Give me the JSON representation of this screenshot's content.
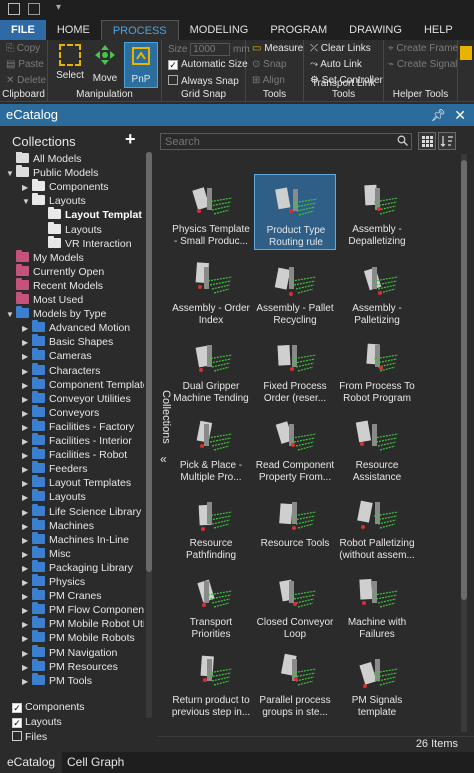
{
  "ribbon_tabs": [
    "FILE",
    "HOME",
    "PROCESS",
    "MODELING",
    "PROGRAM",
    "DRAWING",
    "HELP"
  ],
  "active_tab": "PROCESS",
  "clipboard": {
    "copy": "Copy",
    "paste": "Paste",
    "delete": "Delete",
    "label": "Clipboard"
  },
  "manipulation": {
    "select": "Select",
    "move": "Move",
    "pnp": "PnP",
    "label": "Manipulation"
  },
  "grid_snap": {
    "size_label": "Size",
    "size_value": "1000",
    "size_unit": "mm",
    "automatic_size": "Automatic Size",
    "always_snap": "Always Snap",
    "label": "Grid Snap"
  },
  "tools": {
    "measure": "Measure",
    "snap": "Snap",
    "align": "Align",
    "label": "Tools"
  },
  "transport": {
    "clear_links": "Clear Links",
    "auto_link": "Auto Link",
    "set_controller": "Set Controller",
    "label": "Transport Link Tools"
  },
  "helper": {
    "create_frame": "Create Frame",
    "create_signal": "Create Signal",
    "label": "Helper Tools"
  },
  "panel_title": "eCatalog",
  "collections_title": "Collections",
  "collections_tab_label": "Collections",
  "search_placeholder": "Search",
  "tree": [
    {
      "label": "All Models",
      "indent": 0,
      "arrow": "",
      "color": "#dcdcdc"
    },
    {
      "label": "Public Models",
      "indent": 0,
      "arrow": "▼",
      "color": "#dcdcdc"
    },
    {
      "label": "Components",
      "indent": 1,
      "arrow": "▶",
      "color": "#e8e8e8"
    },
    {
      "label": "Layouts",
      "indent": 1,
      "arrow": "▼",
      "color": "#e8e8e8"
    },
    {
      "label": "Layout Templat",
      "indent": 2,
      "arrow": "",
      "color": "#e8e8e8",
      "bold": true
    },
    {
      "label": "Layouts",
      "indent": 2,
      "arrow": "",
      "color": "#e8e8e8"
    },
    {
      "label": "VR Interaction",
      "indent": 2,
      "arrow": "",
      "color": "#e8e8e8"
    },
    {
      "label": "My Models",
      "indent": 0,
      "arrow": "",
      "color": "#c4527d"
    },
    {
      "label": "Currently Open",
      "indent": 0,
      "arrow": "",
      "color": "#c4527d"
    },
    {
      "label": "Recent Models",
      "indent": 0,
      "arrow": "",
      "color": "#c4527d"
    },
    {
      "label": "Most Used",
      "indent": 0,
      "arrow": "",
      "color": "#c4527d"
    },
    {
      "label": "Models by Type",
      "indent": 0,
      "arrow": "▼",
      "color": "#3a7fd0"
    },
    {
      "label": "Advanced Motion",
      "indent": 1,
      "arrow": "▶",
      "color": "#3a7fd0"
    },
    {
      "label": "Basic Shapes",
      "indent": 1,
      "arrow": "▶",
      "color": "#3a7fd0"
    },
    {
      "label": "Cameras",
      "indent": 1,
      "arrow": "▶",
      "color": "#3a7fd0"
    },
    {
      "label": "Characters",
      "indent": 1,
      "arrow": "▶",
      "color": "#3a7fd0"
    },
    {
      "label": "Component Template",
      "indent": 1,
      "arrow": "▶",
      "color": "#3a7fd0"
    },
    {
      "label": "Conveyor Utilities",
      "indent": 1,
      "arrow": "▶",
      "color": "#3a7fd0"
    },
    {
      "label": "Conveyors",
      "indent": 1,
      "arrow": "▶",
      "color": "#3a7fd0"
    },
    {
      "label": "Facilities - Factory",
      "indent": 1,
      "arrow": "▶",
      "color": "#3a7fd0"
    },
    {
      "label": "Facilities - Interior",
      "indent": 1,
      "arrow": "▶",
      "color": "#3a7fd0"
    },
    {
      "label": "Facilities - Robot",
      "indent": 1,
      "arrow": "▶",
      "color": "#3a7fd0"
    },
    {
      "label": "Feeders",
      "indent": 1,
      "arrow": "▶",
      "color": "#3a7fd0"
    },
    {
      "label": "Layout Templates",
      "indent": 1,
      "arrow": "▶",
      "color": "#3a7fd0"
    },
    {
      "label": "Layouts",
      "indent": 1,
      "arrow": "▶",
      "color": "#3a7fd0"
    },
    {
      "label": "Life Science Library",
      "indent": 1,
      "arrow": "▶",
      "color": "#3a7fd0"
    },
    {
      "label": "Machines",
      "indent": 1,
      "arrow": "▶",
      "color": "#3a7fd0"
    },
    {
      "label": "Machines In-Line",
      "indent": 1,
      "arrow": "▶",
      "color": "#3a7fd0"
    },
    {
      "label": "Misc",
      "indent": 1,
      "arrow": "▶",
      "color": "#3a7fd0"
    },
    {
      "label": "Packaging Library",
      "indent": 1,
      "arrow": "▶",
      "color": "#3a7fd0"
    },
    {
      "label": "Physics",
      "indent": 1,
      "arrow": "▶",
      "color": "#3a7fd0"
    },
    {
      "label": "PM Cranes",
      "indent": 1,
      "arrow": "▶",
      "color": "#3a7fd0"
    },
    {
      "label": "PM Flow Component",
      "indent": 1,
      "arrow": "▶",
      "color": "#3a7fd0"
    },
    {
      "label": "PM Mobile Robot Uti",
      "indent": 1,
      "arrow": "▶",
      "color": "#3a7fd0"
    },
    {
      "label": "PM Mobile Robots",
      "indent": 1,
      "arrow": "▶",
      "color": "#3a7fd0"
    },
    {
      "label": "PM Navigation",
      "indent": 1,
      "arrow": "▶",
      "color": "#3a7fd0"
    },
    {
      "label": "PM Resources",
      "indent": 1,
      "arrow": "▶",
      "color": "#3a7fd0"
    },
    {
      "label": "PM Tools",
      "indent": 1,
      "arrow": "▶",
      "color": "#3a7fd0"
    }
  ],
  "filters": [
    {
      "label": "Components",
      "checked": true
    },
    {
      "label": "Layouts",
      "checked": true
    },
    {
      "label": "Files",
      "checked": false
    }
  ],
  "items": [
    {
      "caption": "Physics Template - Small Produc...",
      "selected": false
    },
    {
      "caption": "Product Type Routing rule",
      "selected": true
    },
    {
      "caption": "Assembly - Depalletizing",
      "selected": false
    },
    {
      "caption": "Assembly - Order Index",
      "selected": false
    },
    {
      "caption": "Assembly - Pallet Recycling",
      "selected": false
    },
    {
      "caption": "Assembly - Palletizing",
      "selected": false
    },
    {
      "caption": "Dual Gripper Machine Tending",
      "selected": false
    },
    {
      "caption": "Fixed Process Order (reser...",
      "selected": false
    },
    {
      "caption": "From Process To Robot Program",
      "selected": false
    },
    {
      "caption": "Pick & Place - Multiple Pro...",
      "selected": false
    },
    {
      "caption": "Read Component Property From...",
      "selected": false
    },
    {
      "caption": "Resource Assistance",
      "selected": false
    },
    {
      "caption": "Resource Pathfinding",
      "selected": false
    },
    {
      "caption": "Resource Tools",
      "selected": false
    },
    {
      "caption": "Robot Palletizing (without assem...",
      "selected": false
    },
    {
      "caption": "Transport Priorities",
      "selected": false
    },
    {
      "caption": "Closed Conveyor Loop",
      "selected": false
    },
    {
      "caption": "Machine with Failures",
      "selected": false
    },
    {
      "caption": "Return product to previous step in...",
      "selected": false
    },
    {
      "caption": "Parallel process groups in ste...",
      "selected": false
    },
    {
      "caption": "PM Signals template",
      "selected": false
    }
  ],
  "item_count": "26 Items",
  "bottom_tabs": [
    "eCatalog",
    "Cell Graph"
  ]
}
